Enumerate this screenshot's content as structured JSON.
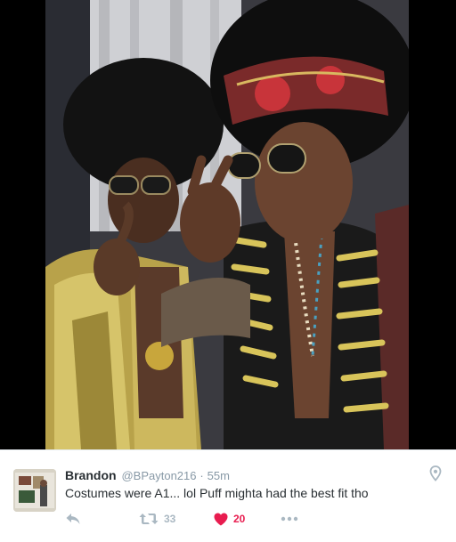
{
  "photo": {
    "alt": "Two people in 1970s-style costumes with large afro wigs and round sunglasses"
  },
  "tweet": {
    "display_name": "Brandon",
    "handle": "@BPayton216",
    "separator": "·",
    "timestamp": "55m",
    "text": "Costumes were A1... lol Puff mighta had the best fit tho",
    "actions": {
      "retweet_count": "33",
      "like_count": "20",
      "liked": true
    }
  },
  "icons": {
    "reply": "reply-icon",
    "retweet": "retweet-icon",
    "like": "heart-icon",
    "more": "more-icon",
    "location": "location-pin-icon"
  },
  "colors": {
    "name": "#292f33",
    "meta": "#8899a6",
    "action_gray": "#aab8c2",
    "like_red": "#e81c4f",
    "photo_bg": "#000000"
  }
}
